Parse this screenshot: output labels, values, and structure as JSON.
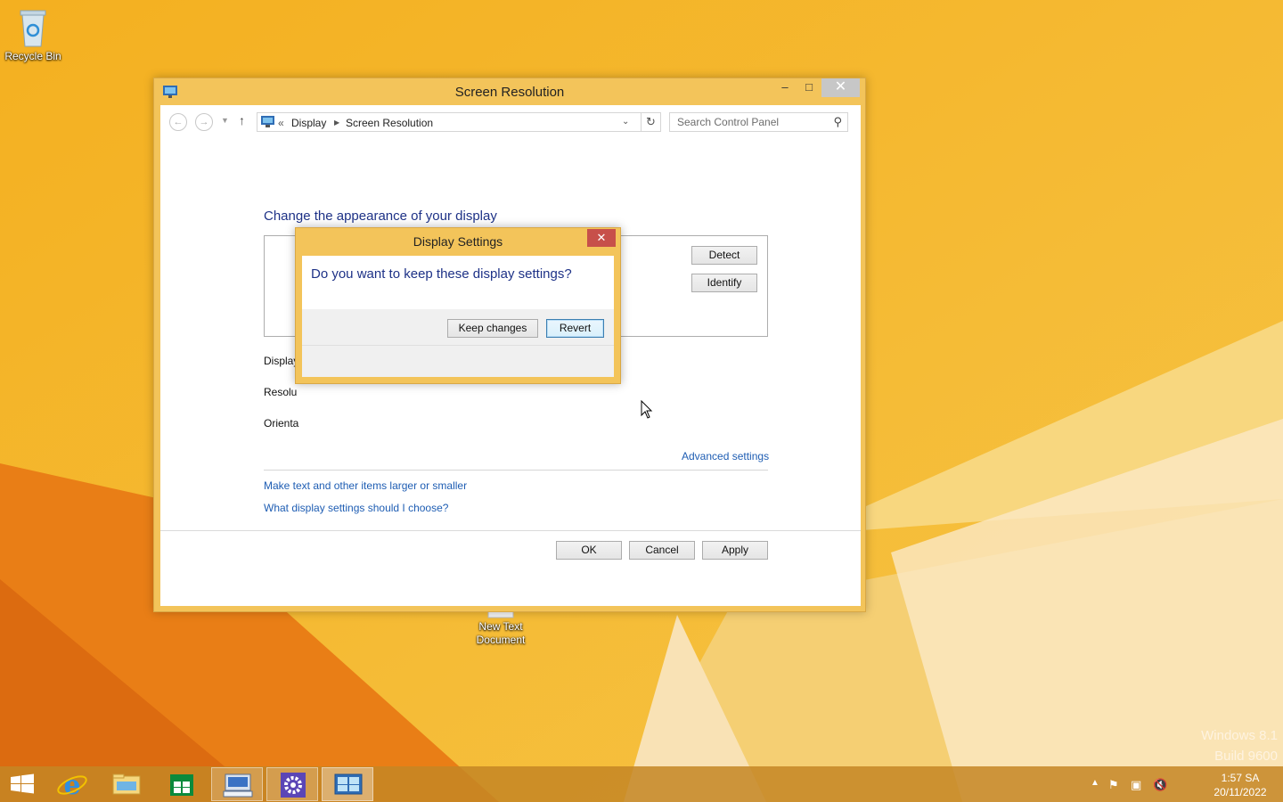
{
  "desktop": {
    "icons": [
      {
        "label": "Recycle Bin"
      },
      {
        "label": "New Text Document"
      }
    ],
    "watermark": {
      "line1": "Windows 8.1",
      "line2": "Build 9600"
    }
  },
  "main_window": {
    "title": "Screen Resolution",
    "nav": {
      "breadcrumb_prefix": "«",
      "breadcrumb": [
        "Display",
        "Screen Resolution"
      ],
      "search_placeholder": "Search Control Panel"
    },
    "heading": "Change the appearance of your display",
    "buttons": {
      "detect": "Detect",
      "identify": "Identify",
      "ok": "OK",
      "cancel": "Cancel",
      "apply": "Apply"
    },
    "fields": {
      "display": "Display",
      "resolution": "Resolu",
      "orientation": "Orienta"
    },
    "links": {
      "advanced": "Advanced settings",
      "text_size": "Make text and other items larger or smaller",
      "help": "What display settings should I choose?"
    }
  },
  "dialog": {
    "title": "Display Settings",
    "message": "Do you want to keep these display settings?",
    "keep_label": "Keep changes",
    "revert_label": "Revert"
  },
  "taskbar": {
    "clock_time": "1:57 SA",
    "clock_date": "20/11/2022"
  },
  "colors": {
    "accent_title": "#f3c45a",
    "heading_blue": "#1e3287",
    "link_blue": "#1e5db3"
  }
}
